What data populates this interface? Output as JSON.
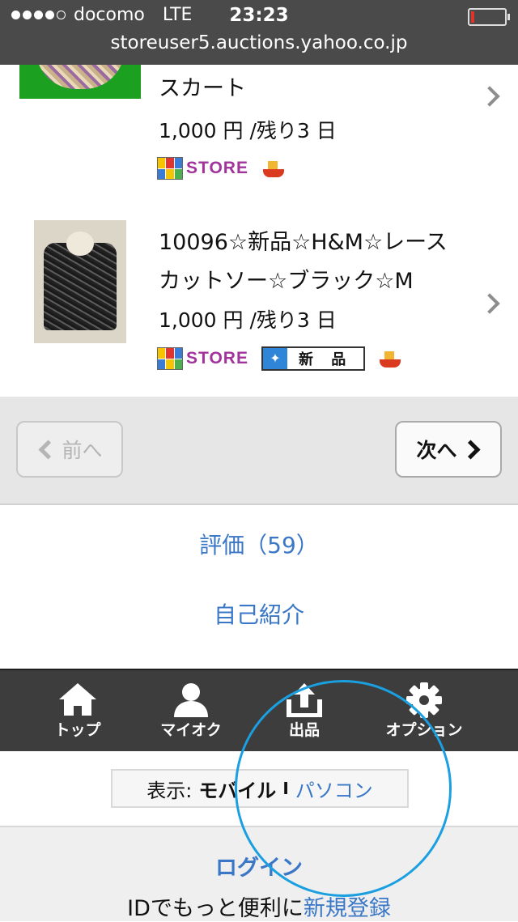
{
  "status_bar": {
    "carrier": "docomo",
    "network": "LTE",
    "time": "23:23",
    "url": "storeuser5.auctions.yahoo.co.jp",
    "signal_bars_filled": 4,
    "battery_level": 0.05
  },
  "items": [
    {
      "title_line2": "スカート",
      "price": "1,000 円 /残り3 日",
      "badges": [
        "STORE",
        "ship-icon"
      ]
    },
    {
      "title_line1": "10096☆新品☆H&M☆レース",
      "title_line2": "カットソー☆ブラック☆M",
      "price": "1,000 円 /残り3 日",
      "badges": [
        "STORE",
        "新 品",
        "ship-icon"
      ]
    }
  ],
  "store_badge_text": "STORE",
  "new_badge_text": "新 品",
  "pager": {
    "prev_label": "前へ",
    "next_label": "次へ"
  },
  "links": {
    "rating": "評価（59）",
    "profile": "自己紹介"
  },
  "navbar": {
    "items": [
      {
        "label": "トップ",
        "icon": "home-icon"
      },
      {
        "label": "マイオク",
        "icon": "person-icon"
      },
      {
        "label": "出品",
        "icon": "upload-icon"
      },
      {
        "label": "オプション",
        "icon": "gear-icon"
      }
    ]
  },
  "display_toggle": {
    "prefix": "表示:",
    "mobile": "モバイル",
    "separator": "I",
    "pc": "パソコン"
  },
  "login": {
    "title": "ログイン",
    "sub_text": "IDでもっと便利に",
    "register": "新規登録"
  },
  "colors": {
    "link": "#3a78c7",
    "highlight_circle": "#1a9fe0",
    "navbar": "#3d3d3d"
  }
}
